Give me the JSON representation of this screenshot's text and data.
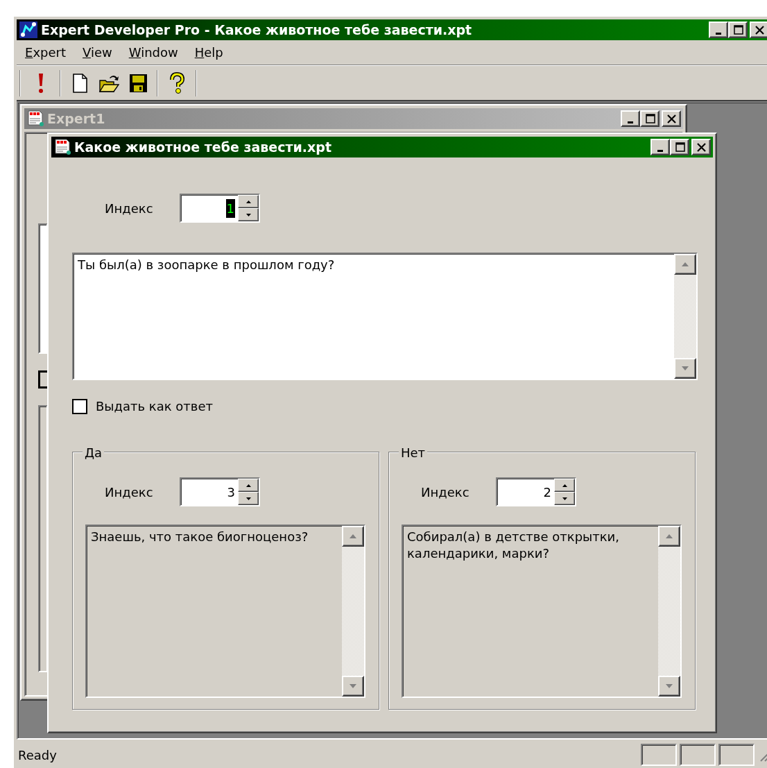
{
  "app_window": {
    "title": "Expert Developer Pro - Какое животное тебе завести.xpt",
    "active": true
  },
  "menu": [
    {
      "label": "Expert"
    },
    {
      "label": "View"
    },
    {
      "label": "Window"
    },
    {
      "label": "Help"
    }
  ],
  "expert_window": {
    "title": "Expert1",
    "active": false
  },
  "document_window": {
    "title": "Какое животное тебе завести.xpt",
    "active": true,
    "index": {
      "label": "Индекс",
      "value": "1",
      "selected": true
    },
    "question": {
      "text": "Ты был(а) в зоопарке в прошлом году?",
      "disabled": false
    },
    "answer_checkbox": {
      "label": "Выдать как ответ",
      "checked": false
    },
    "groups": [
      {
        "legend": "Да",
        "index_label": "Индекс",
        "index_value": "3",
        "text": "Знаешь, что такое биогноценоз?",
        "disabled": true
      },
      {
        "legend": "Нет",
        "index_label": "Индекс",
        "index_value": "2",
        "text": "Собирал(а) в детстве открытки, календарики, марки?",
        "disabled": true
      }
    ]
  },
  "status_bar": {
    "text": "Ready"
  }
}
